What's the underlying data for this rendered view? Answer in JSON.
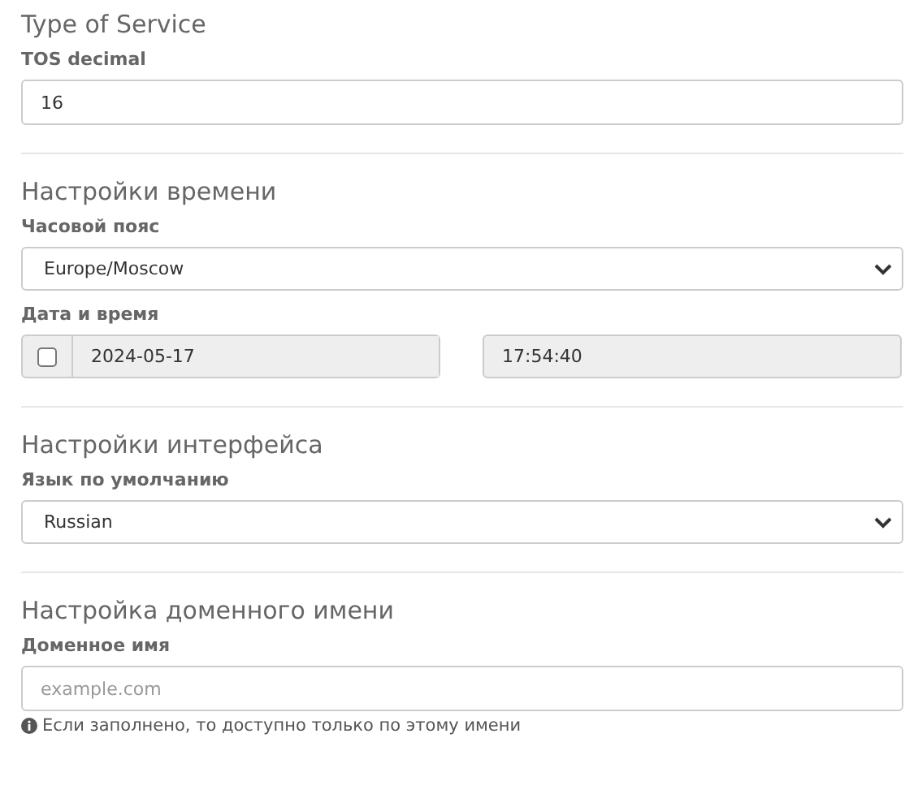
{
  "sections": [
    {
      "title": "Type of Service",
      "fields": [
        {
          "kind": "text",
          "label": "TOS decimal",
          "value": "16"
        }
      ]
    },
    {
      "title": "Настройки времени",
      "fields": [
        {
          "kind": "select",
          "label": "Часовой пояс",
          "value": "Europe/Moscow"
        },
        {
          "kind": "datetime",
          "label": "Дата и время",
          "checked": false,
          "date": "2024-05-17",
          "time": "17:54:40"
        }
      ]
    },
    {
      "title": "Настройки интерфейса",
      "fields": [
        {
          "kind": "select",
          "label": "Язык по умолчанию",
          "value": "Russian"
        }
      ]
    },
    {
      "title": "Настройка доменного имени",
      "fields": [
        {
          "kind": "text",
          "label": "Доменное имя",
          "placeholder": "example.com",
          "hint": "Если заполнено, то доступно только по этому имени"
        }
      ]
    }
  ]
}
